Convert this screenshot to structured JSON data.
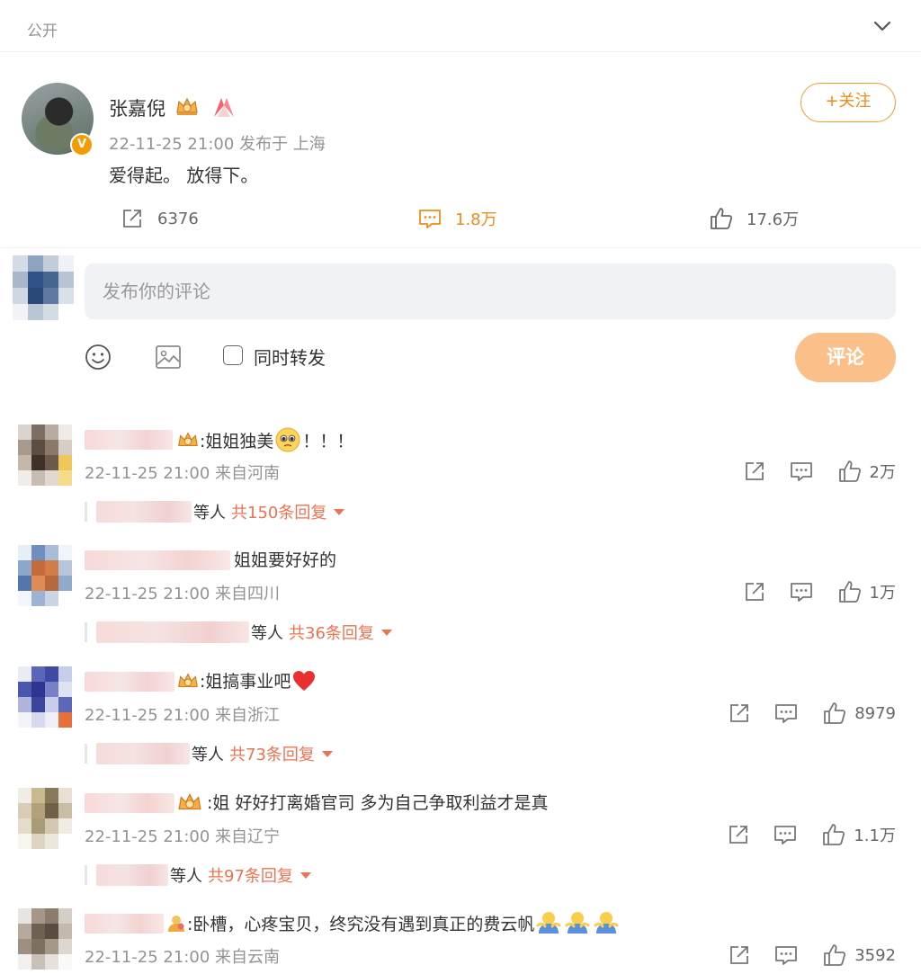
{
  "visibility": {
    "label": "公开"
  },
  "post": {
    "author": "张嘉倪",
    "timestamp": "22-11-25 21:00",
    "location": "发布于 上海",
    "text": "爱得起。 放得下。",
    "follow_label": "+关注",
    "verified_mark": "V",
    "stats": {
      "reposts": "6376",
      "comments": "1.8万",
      "likes": "17.6万"
    }
  },
  "composer": {
    "placeholder": "发布你的评论",
    "forward_label": "同时转发",
    "submit_label": "评论"
  },
  "comments": [
    {
      "text": ":姐姐独美",
      "suffix": "！！！",
      "emoji": "pleading-face",
      "timestamp": "22-11-25 21:00",
      "location": "来自河南",
      "likes": "2万",
      "reply_who": "等人",
      "reply_count": "共150条回复"
    },
    {
      "text": "姐姐要好好的",
      "suffix": "",
      "emoji": "",
      "timestamp": "22-11-25 21:00",
      "location": "来自四川",
      "likes": "1万",
      "reply_who": "等人",
      "reply_count": "共36条回复"
    },
    {
      "text": ":姐搞事业吧",
      "suffix": "",
      "emoji": "red-heart",
      "timestamp": "22-11-25 21:00",
      "location": "来自浙江",
      "likes": "8979",
      "reply_who": "等人",
      "reply_count": "共73条回复"
    },
    {
      "text": ":姐 好好打离婚官司 多为自己争取利益才是真",
      "suffix": "",
      "emoji": "",
      "timestamp": "22-11-25 21:00",
      "location": "来自辽宁",
      "likes": "1.1万",
      "reply_who": "等人",
      "reply_count": "共97条回复"
    },
    {
      "text": ":卧槽，心疼宝贝，终究没有遇到真正的费云帆",
      "suffix": "",
      "emoji": "hug-figures",
      "timestamp": "22-11-25 21:00",
      "location": "来自云南",
      "likes": "3592",
      "reply_who": "",
      "reply_count": ""
    }
  ],
  "colors": {
    "accent": "#f08a18",
    "reply_link": "#eb7350",
    "muted_text": "#939393",
    "submit_bg": "#fbc08a"
  }
}
